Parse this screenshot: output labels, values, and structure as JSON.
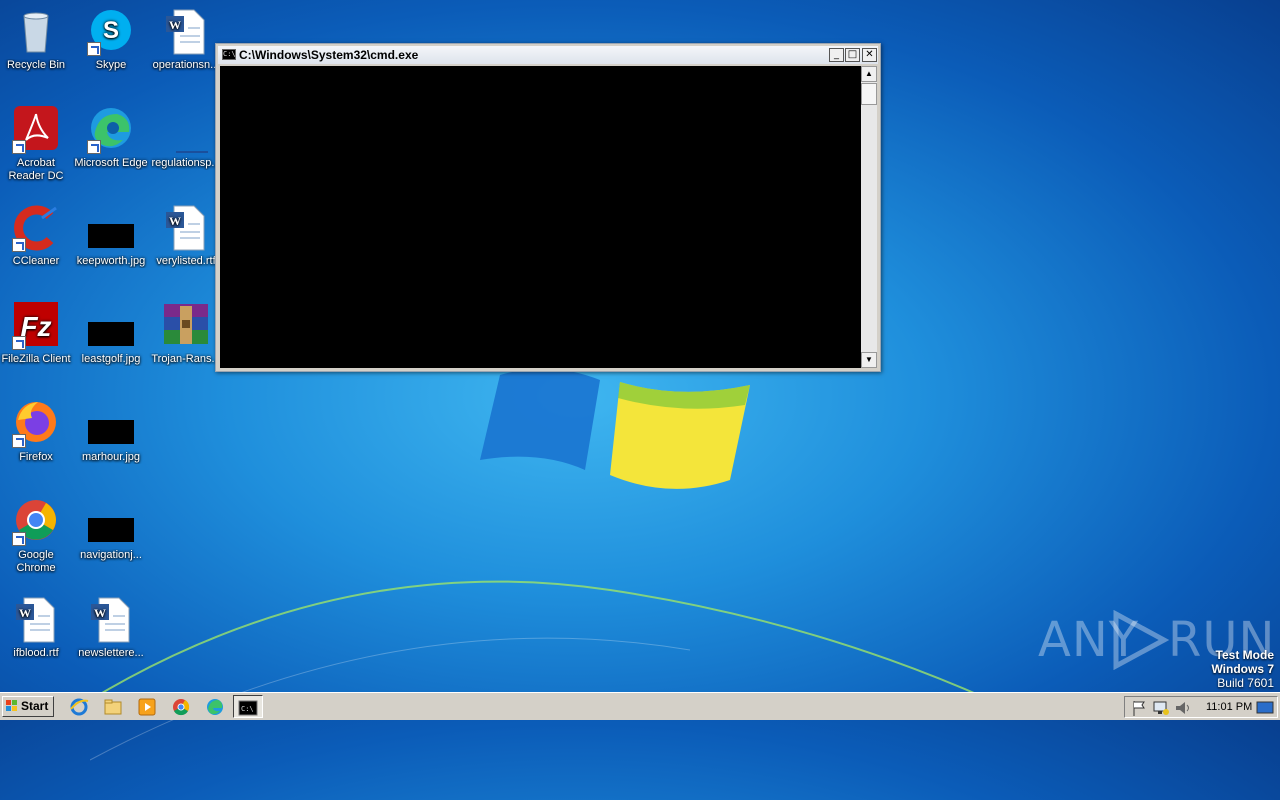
{
  "desktop": {
    "icons": [
      {
        "label": "Recycle Bin",
        "icon": "recycle-bin-icon"
      },
      {
        "label": "Skype",
        "icon": "skype-icon"
      },
      {
        "label": "operationsn...",
        "icon": "word-document-icon"
      },
      {
        "label": "Acrobat Reader DC",
        "icon": "acrobat-icon"
      },
      {
        "label": "Microsoft Edge",
        "icon": "edge-icon"
      },
      {
        "label": "regulationsp...",
        "icon": "blank-file-icon"
      },
      {
        "label": "CCleaner",
        "icon": "ccleaner-icon"
      },
      {
        "label": "keepworth.jpg",
        "icon": "image-file-icon"
      },
      {
        "label": "verylisted.rtf",
        "icon": "word-document-icon"
      },
      {
        "label": "FileZilla Client",
        "icon": "filezilla-icon"
      },
      {
        "label": "leastgolf.jpg",
        "icon": "image-file-icon"
      },
      {
        "label": "Trojan-Rans...",
        "icon": "winrar-icon"
      },
      {
        "label": "Firefox",
        "icon": "firefox-icon"
      },
      {
        "label": "marhour.jpg",
        "icon": "image-file-icon"
      },
      {
        "label": "Google Chrome",
        "icon": "chrome-icon"
      },
      {
        "label": "navigationj...",
        "icon": "image-file-icon"
      },
      {
        "label": "ifblood.rtf",
        "icon": "word-document-icon"
      },
      {
        "label": "newslettere...",
        "icon": "word-document-icon"
      }
    ]
  },
  "cmd_window": {
    "title": "C:\\Windows\\System32\\cmd.exe",
    "icon_text": "C:\\",
    "minimize": "_",
    "maximize": "□",
    "close": "✕",
    "scroll_up": "▲",
    "scroll_down": "▼"
  },
  "watermark": {
    "brand_left": "ANY",
    "brand_right": "RUN",
    "test_mode": "Test Mode",
    "os_name": "Windows 7",
    "build": "Build 7601"
  },
  "taskbar": {
    "start_label": "Start",
    "clock": "11:01 PM",
    "pinned": [
      "internet-explorer-icon",
      "explorer-icon",
      "media-player-icon",
      "chrome-icon",
      "edge-icon",
      "cmd-icon"
    ]
  },
  "colors": {
    "desktop_blue": "#1f8fdc",
    "taskbar": "#d4d0c8",
    "console": "#000000"
  }
}
